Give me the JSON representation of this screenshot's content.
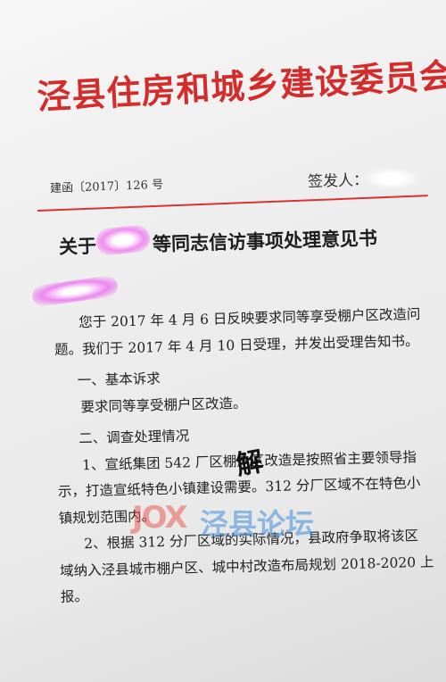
{
  "header": {
    "agency_title": "泾县住房和城乡建设委员会文件",
    "doc_number": "建函〔2017〕126 号",
    "issuer_label": "签发人："
  },
  "title": {
    "text": "关于　　　等同志信访事项处理意见书"
  },
  "body": {
    "intro_line1": "您于 2017 年 4 月 6 日反映要求同等享受棚户区改造问",
    "intro_line2": "题。我们于 2017 年 4 月 10 日受理，并发出受理告知书。",
    "section1_title": "一、基本诉求",
    "section1_text": "要求同等享受棚户区改造。",
    "section2_title": "二、调查处理情况",
    "para1_line1": "1、宣纸集团 542 厂区棚户区改造是按照省主要领导指",
    "para1_line2": "示，打造宣纸特色小镇建设需要。312 分厂区域不在特色小",
    "para1_line3": "镇规划范围内。",
    "para2_line1": "2、根据 312 分厂区域的实际情况，县政府争取将该区",
    "para2_line2": "域纳入泾县城市棚户区、城中村改造布局规划 2018-2020 上",
    "para2_line3": "报。"
  },
  "overlay": {
    "stamp_char": "解",
    "watermark_logo": "JOX",
    "watermark_text": "泾县论坛"
  },
  "colors": {
    "header_red": "#d42b2b",
    "rule_red": "#d9342f",
    "redaction_pink": "#ec86ee"
  }
}
